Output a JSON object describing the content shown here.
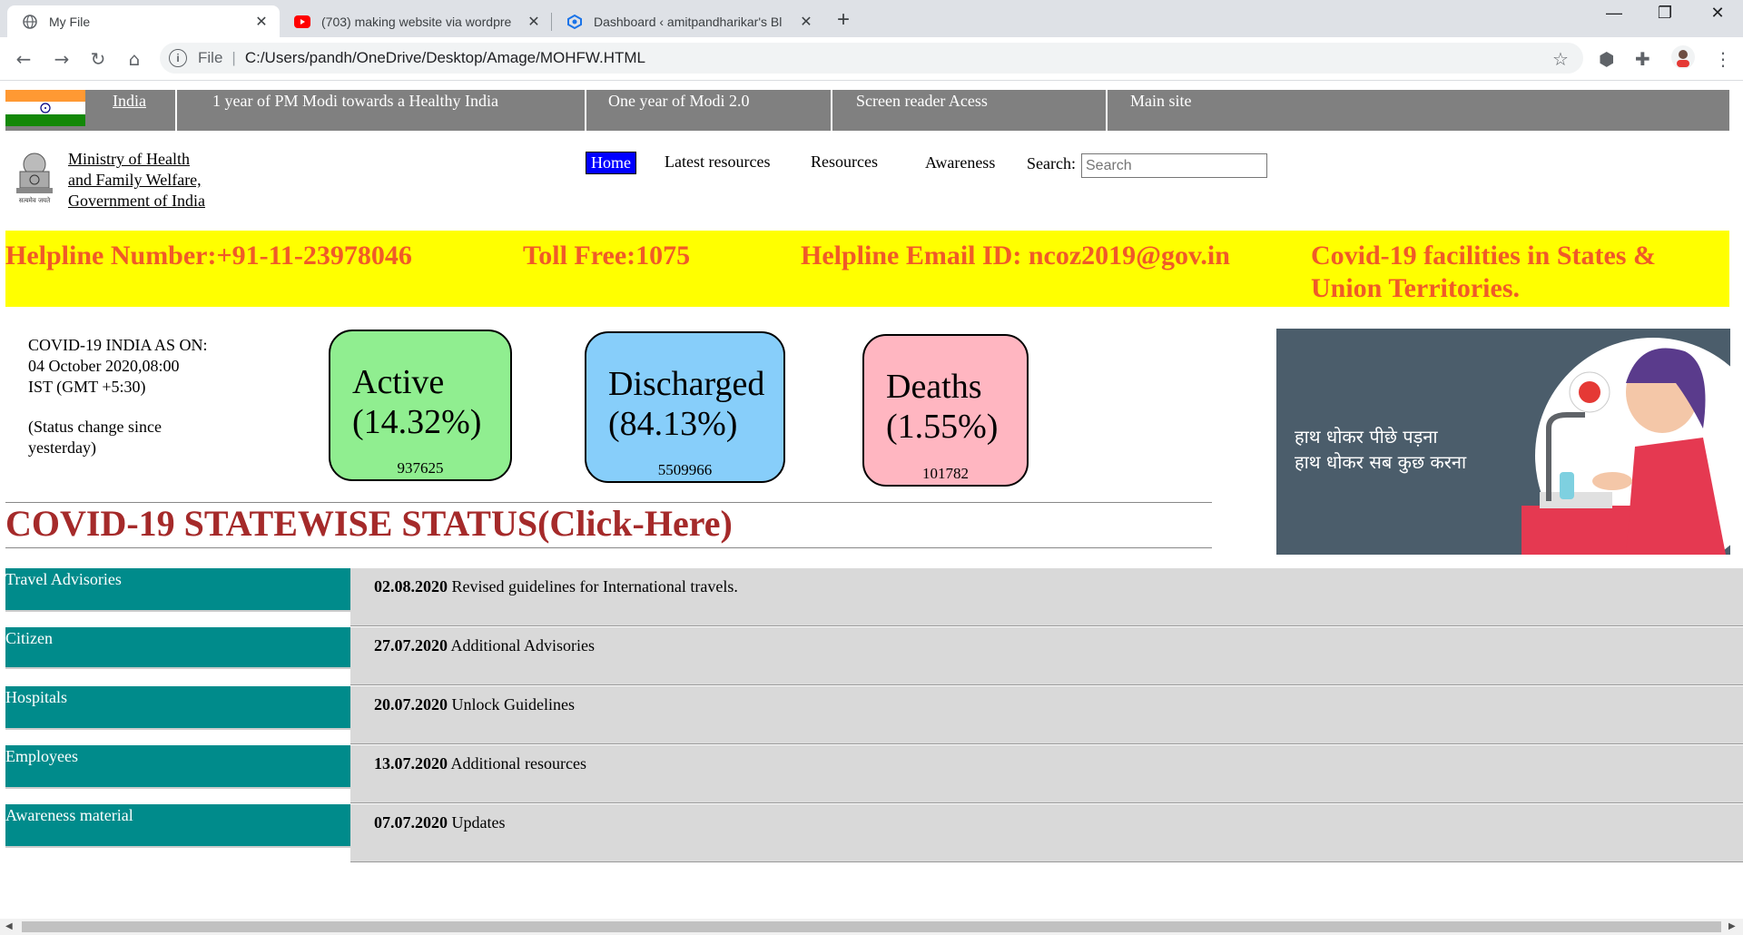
{
  "browser": {
    "tabs": [
      {
        "title": "My File",
        "icon": "globe-icon",
        "active": true
      },
      {
        "title": "(703) making website via wordpre",
        "icon": "youtube-icon",
        "active": false
      },
      {
        "title": "Dashboard ‹ amitpandharikar's Bl",
        "icon": "blog-icon",
        "active": false
      }
    ],
    "url_scheme": "File",
    "url": "C:/Users/pandh/OneDrive/Desktop/Amage/MOHFW.HTML"
  },
  "topbar": {
    "items": [
      "India",
      "1 year of PM Modi towards a Healthy India",
      "One year of Modi 2.0",
      "Screen reader Acess",
      "Main site"
    ]
  },
  "header": {
    "ministry": [
      "Ministry of Health",
      "and Family Welfare,",
      "Government of India"
    ],
    "nav": [
      "Home",
      "Latest resources",
      "Resources",
      "Awareness"
    ],
    "search_label": "Search:",
    "search_placeholder": "Search"
  },
  "helpline": {
    "number": "Helpline Number:+91-11-23978046",
    "tollfree": "Toll Free:1075",
    "email": "Helpline Email ID: ncoz2019@gov.in",
    "facilities": "Covid-19 facilities in States & Union Territories."
  },
  "status": {
    "as_on": [
      "COVID-19 INDIA AS ON:",
      "04 October 2020,08:00",
      "IST (GMT +5:30)"
    ],
    "change": [
      "(Status change since",
      "yesterday)"
    ],
    "cards": [
      {
        "label": "Active",
        "pct": "(14.32%)",
        "count": "937625",
        "color": "#90ee90"
      },
      {
        "label": "Discharged",
        "pct": "(84.13%)",
        "count": "5509966",
        "color": "#87cefa"
      },
      {
        "label": "Deaths",
        "pct": "(1.55%)",
        "count": "101782",
        "color": "#ffb6c1"
      }
    ]
  },
  "statewise_link": "COVID-19 STATEWISE STATUS(Click-Here)",
  "banner": {
    "lines": [
      "हाथ धोकर पीछे पड़ना",
      "हाथ धोकर सब कुछ करना"
    ]
  },
  "advisories": [
    {
      "category": "Travel Advisories",
      "date": "02.08.2020",
      "text": "Revised guidelines for International travels."
    },
    {
      "category": "Citizen",
      "date": "27.07.2020",
      "text": "Additional Advisories"
    },
    {
      "category": "Hospitals",
      "date": "20.07.2020",
      "text": "Unlock Guidelines"
    },
    {
      "category": "Employees",
      "date": "13.07.2020",
      "text": "Additional resources"
    },
    {
      "category": "Awareness material",
      "date": "07.07.2020",
      "text": "Updates"
    }
  ]
}
